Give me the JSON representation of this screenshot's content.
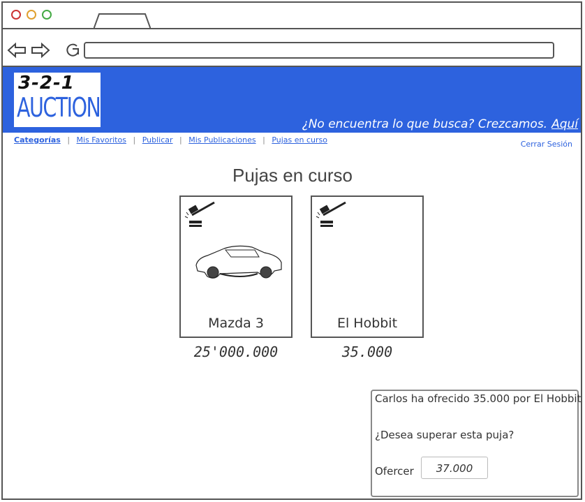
{
  "browser": {
    "window_controls": [
      "close-dot",
      "minimize-dot",
      "maximize-dot"
    ],
    "url": "",
    "colors": {
      "close": "#cc3333",
      "minimize": "#e0a030",
      "maximize": "#44aa44"
    }
  },
  "banner": {
    "logo_top": "3-2-1",
    "logo_bottom": "AUCTION",
    "tagline": "¿No encuentra lo que busca? Crezcamos.",
    "tagline_link": "Aquí",
    "color": "#2d62de"
  },
  "menu": {
    "items": [
      "Categorías",
      "Mis Favoritos",
      "Publicar",
      "Mis Publicaciones",
      "Pujas en curso"
    ],
    "separator": "|",
    "logout": "Cerrar Sesión"
  },
  "page_title": "Pujas en curso",
  "auctions": [
    {
      "name": "Mazda 3",
      "price": "25'000.000",
      "image": "car-image"
    },
    {
      "name": "El Hobbit",
      "price": "35.000",
      "image": ""
    }
  ],
  "notification": {
    "message": "Carlos ha ofrecido 35.000 por El Hobbit",
    "question": "¿Desea superar esta puja?",
    "offer_label": "Ofercer",
    "offer_value": "37.000"
  }
}
